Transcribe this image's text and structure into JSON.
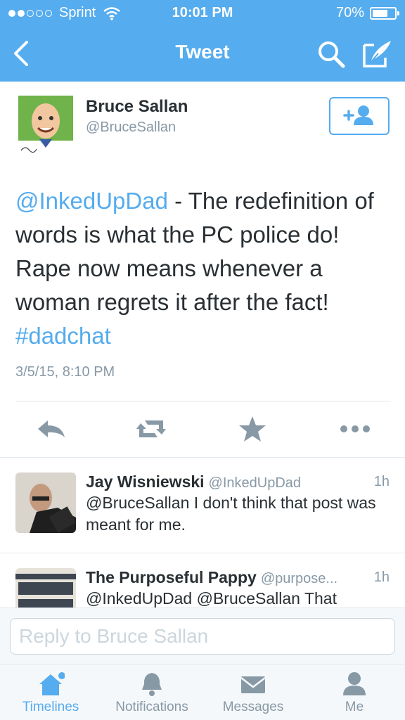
{
  "status_bar": {
    "carrier": "Sprint",
    "time": "10:01 PM",
    "battery": "70%",
    "battery_level": 0.7
  },
  "nav": {
    "title": "Tweet"
  },
  "tweet": {
    "author_name": "Bruce Sallan",
    "author_handle": "@BruceSallan",
    "mention": "@InkedUpDad",
    "body": " - The redefinition of words is what the PC police do! Rape now means whenever a woman regrets it after the fact! ",
    "hashtag": "#dadchat",
    "date": "3/5/15, 8:10 PM"
  },
  "replies": [
    {
      "name": "Jay Wisniewski",
      "handle": "@InkedUpDad",
      "time": "1h",
      "text": "@BruceSallan I don't think that post was meant for me."
    },
    {
      "name": "The Purposeful Pappy",
      "handle": "@purpose...",
      "time": "1h",
      "text": "@InkedUpDad @BruceSallan That"
    }
  ],
  "reply_bar": {
    "placeholder": "Reply to Bruce Sallan"
  },
  "tabs": [
    {
      "label": "Timelines",
      "icon": "home-icon",
      "active": true
    },
    {
      "label": "Notifications",
      "icon": "bell-icon",
      "active": false
    },
    {
      "label": "Messages",
      "icon": "envelope-icon",
      "active": false
    },
    {
      "label": "Me",
      "icon": "person-icon",
      "active": false
    }
  ],
  "colors": {
    "brand": "#55acee",
    "text": "#292f33",
    "muted": "#8899a6",
    "icon": "#8899a6"
  }
}
